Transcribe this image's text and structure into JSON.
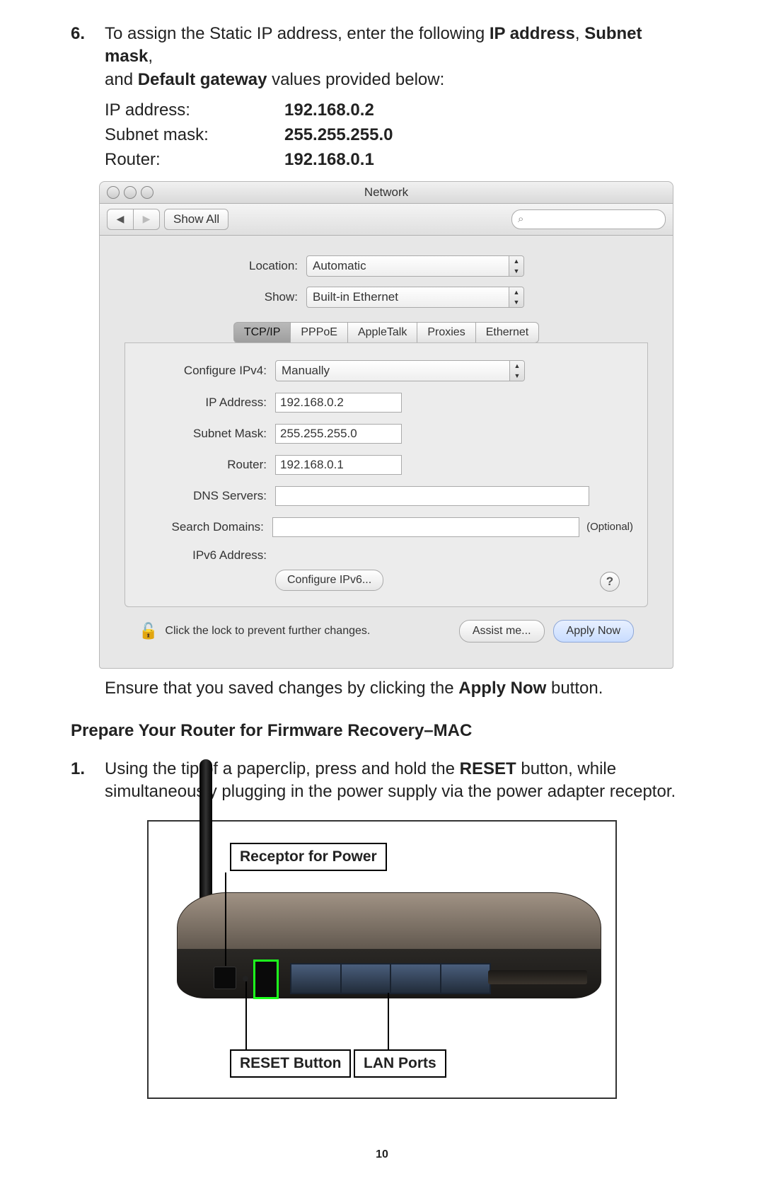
{
  "step6": {
    "num": "6.",
    "line1a": "To assign the Static IP address, enter the following ",
    "b1": "IP address",
    "c1": ", ",
    "b2": "Subnet mask",
    "c2": ",",
    "line2a": "and ",
    "b3": "Default gateway",
    "line2b": " values provided below:"
  },
  "vals": {
    "ip_lab": "IP address:",
    "ip_val": "192.168.0.2",
    "sn_lab": "Subnet mask:",
    "sn_val": "255.255.255.0",
    "rt_lab": "Router:",
    "rt_val": "192.168.0.1"
  },
  "win": {
    "title": "Network",
    "show_all": "Show All",
    "search_glyph": "⌕",
    "loc_label": "Location:",
    "loc_value": "Automatic",
    "show_label": "Show:",
    "show_value": "Built-in Ethernet",
    "tabs": {
      "tcpip": "TCP/IP",
      "pppoe": "PPPoE",
      "atalk": "AppleTalk",
      "proxies": "Proxies",
      "eth": "Ethernet"
    },
    "cfg4_label": "Configure IPv4:",
    "cfg4_value": "Manually",
    "ipaddr_label": "IP Address:",
    "ipaddr_value": "192.168.0.2",
    "subnet_label": "Subnet Mask:",
    "subnet_value": "255.255.255.0",
    "router_label": "Router:",
    "router_value": "192.168.0.1",
    "dns_label": "DNS Servers:",
    "search_label": "Search Domains:",
    "optional": "(Optional)",
    "ipv6_label": "IPv6 Address:",
    "cfg6_btn": "Configure IPv6...",
    "lock_msg": "Click the lock to prevent further changes.",
    "assist": "Assist me...",
    "apply": "Apply Now",
    "help": "?"
  },
  "after_win_a": "Ensure that you saved changes by clicking the ",
  "after_win_b": "Apply Now",
  "after_win_c": " button.",
  "h_prepare": "Prepare Your Router for Firmware Recovery–MAC",
  "step1": {
    "num": "1.",
    "a": "Using the tip of a paperclip, press and hold the ",
    "b": "RESET",
    "c": " button, while",
    "d": "simultaneously plugging in the power supply via the power adapter receptor."
  },
  "fig": {
    "receptor": "Receptor for Power",
    "reset": "RESET Button",
    "lan": "LAN Ports"
  },
  "page_num": "10"
}
